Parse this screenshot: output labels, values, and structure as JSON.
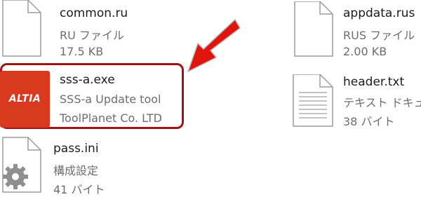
{
  "files": [
    {
      "name": "common.ru",
      "type": "RU ファイル",
      "detail": "17.5 KB",
      "icon": "document-icon"
    },
    {
      "name": "appdata.rus",
      "type": "RUS ファイル",
      "detail": "2.00 KB",
      "icon": "document-icon"
    },
    {
      "name": "sss-a.exe",
      "type": "SSS-a Update tool",
      "detail": "ToolPlanet Co. LTD",
      "icon": "altia-app-icon",
      "icon_text": "ALTIA"
    },
    {
      "name": "header.txt",
      "type": "テキスト ドキュメ",
      "detail": "38 バイト",
      "icon": "text-document-icon"
    },
    {
      "name": "pass.ini",
      "type": "構成設定",
      "detail": "41 バイト",
      "icon": "config-file-icon"
    }
  ],
  "colors": {
    "highlight": "#a31212",
    "arrow": "#e0150e",
    "altia": "#d8391f"
  }
}
